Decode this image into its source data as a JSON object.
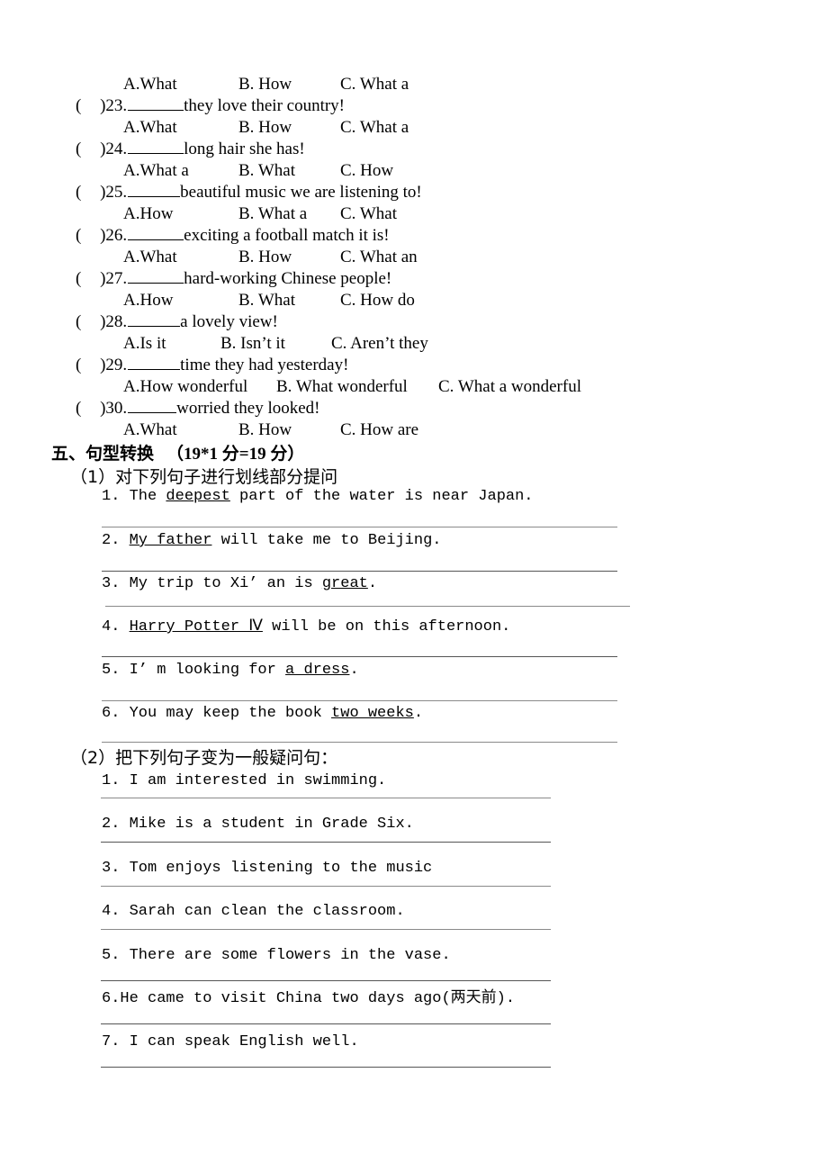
{
  "document": {
    "type": "english-exam-worksheet",
    "language": "zh-CN/en"
  },
  "multiple_choice": {
    "options_label_a": "A.",
    "options_label_b": "B.",
    "options_label_c": "C.",
    "leading_options": {
      "a": "A.What",
      "b": "B. How",
      "c": "C. What a"
    },
    "questions": [
      {
        "paren": "(",
        "paren_close": ")",
        "number": "23.",
        "stem": "they love their country!",
        "options": {
          "a": "A.What",
          "b": "B. How",
          "c": "C. What a"
        }
      },
      {
        "paren": "(",
        "paren_close": ")",
        "number": "24.",
        "stem": "long hair she has!",
        "options": {
          "a": "A.What a",
          "b": "B. What",
          "c": "C. How"
        }
      },
      {
        "paren": "(",
        "paren_close": ")",
        "number": "25.",
        "stem": "beautiful music we are listening to!",
        "options": {
          "a": "A.How",
          "b": "B. What a",
          "c": "C. What"
        }
      },
      {
        "paren": "(",
        "paren_close": ")",
        "number": "26.",
        "stem": "exciting a football match it is!",
        "options": {
          "a": "A.What",
          "b": "B. How",
          "c": "C. What an"
        }
      },
      {
        "paren": "(",
        "paren_close": ")",
        "number": "27.",
        "stem": "hard-working Chinese people!",
        "options": {
          "a": "A.How",
          "b": "B. What",
          "c": "C. How do"
        }
      },
      {
        "paren": "(",
        "paren_close": ")",
        "number": "28.",
        "stem": "a lovely view!",
        "options": {
          "a": "A.Is it",
          "b": "B. Isn’t it",
          "c": "C. Aren’t they"
        }
      },
      {
        "paren": "(",
        "paren_close": ")",
        "number": "29.",
        "stem": "time they had yesterday!",
        "options": {
          "a": "A.How wonderful",
          "b": "B. What wonderful",
          "c": "C. What a wonderful"
        }
      },
      {
        "paren": "(",
        "paren_close": ")",
        "number": "30.",
        "stem": "worried they looked!",
        "options": {
          "a": "A.What",
          "b": "B. How",
          "c": "C. How are"
        }
      }
    ]
  },
  "section_five": {
    "number": "五、",
    "title": "句型转换",
    "score": "（19*1 分=19 分）",
    "part1": {
      "label": "（1）对下列句子进行划线部分提问",
      "items": [
        {
          "number": "1.",
          "pre": " The ",
          "underlined": "deepest",
          "post": " part of the water is near Japan."
        },
        {
          "number": "2.",
          "pre": " ",
          "underlined": "My father",
          "post": " will take me to Beijing."
        },
        {
          "number": "3.",
          "pre": " My trip to Xi’ an is ",
          "underlined": "great",
          "post": "."
        },
        {
          "number": "4.",
          "pre": " ",
          "underlined": "Harry Potter Ⅳ",
          "post": " will be on this afternoon."
        },
        {
          "number": "5.",
          "pre": " I’ m looking for ",
          "underlined": "a dress",
          "post": "."
        },
        {
          "number": "6.",
          "pre": " You may keep the book ",
          "underlined": "two weeks",
          "post": "."
        }
      ]
    },
    "part2": {
      "label": "（2）把下列句子变为一般疑问句：",
      "items": [
        {
          "number": "1.",
          "text": " I am interested in swimming."
        },
        {
          "number": "2.",
          "text": " Mike is a student in Grade Six."
        },
        {
          "number": "3.",
          "text": " Tom enjoys listening to the music"
        },
        {
          "number": "4.",
          "text": " Sarah can clean the classroom."
        },
        {
          "number": "5.",
          "text": " There are some flowers  in  the  vase."
        },
        {
          "number": "6.",
          "text": "He came to visit China two days ago(两天前)."
        },
        {
          "number": "7.",
          "text": " I can speak English well."
        }
      ]
    }
  }
}
